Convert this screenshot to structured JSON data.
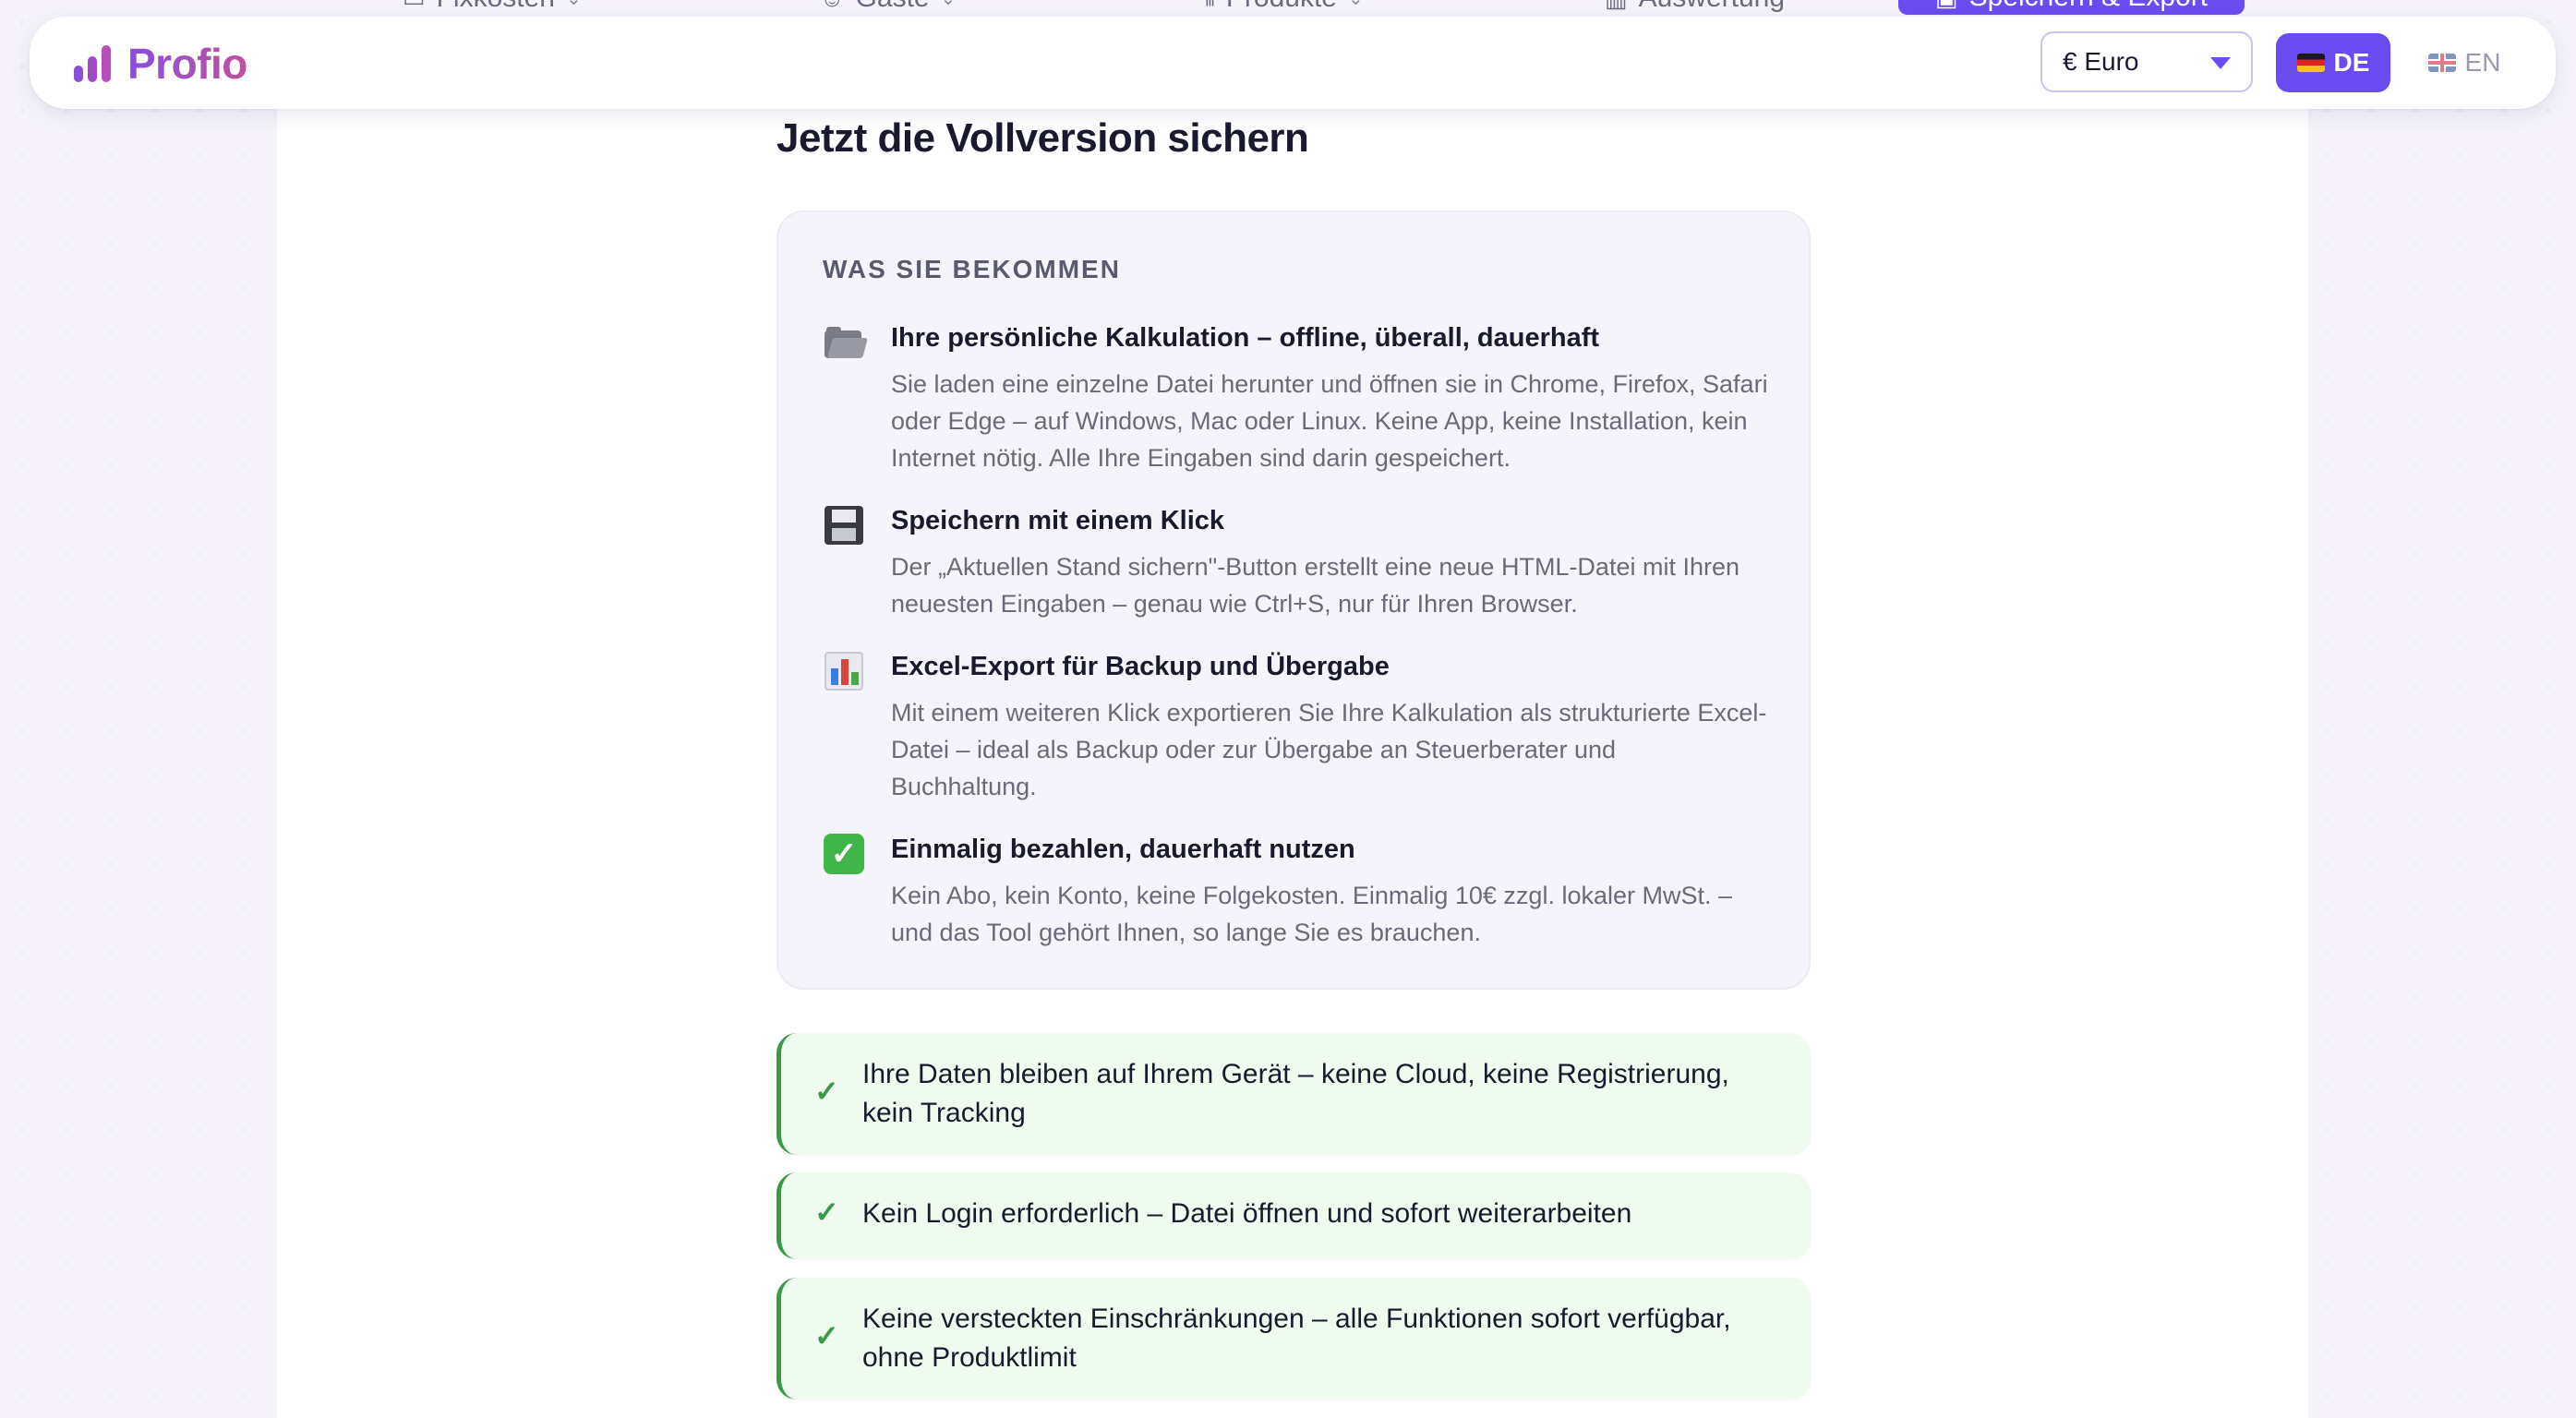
{
  "tabs": [
    {
      "label": "Fixkosten",
      "icon": "file-icon"
    },
    {
      "label": "Gäste",
      "icon": "users-icon"
    },
    {
      "label": "Produkte",
      "icon": "products-icon"
    },
    {
      "label": "Auswertung",
      "icon": "chart-icon"
    },
    {
      "label": "Speichern & Export",
      "icon": "save-icon",
      "active": true
    }
  ],
  "header": {
    "logo_text": "Profio",
    "currency": {
      "value": "€ Euro"
    },
    "lang_de": "DE",
    "lang_en": "EN"
  },
  "main": {
    "title": "Jetzt die Vollversion sichern",
    "card_label": "WAS SIE BEKOMMEN",
    "benefits": [
      {
        "icon": "folder-icon",
        "title": "Ihre persönliche Kalkulation – offline, überall, dauerhaft",
        "body": "Sie laden eine einzelne Datei herunter und öffnen sie in Chrome, Firefox, Safari oder Edge – auf Windows, Mac oder Linux. Keine App, keine Installation, kein Internet nötig. Alle Ihre Eingaben sind darin gespeichert."
      },
      {
        "icon": "floppy-disk-icon",
        "title": "Speichern mit einem Klick",
        "body": "Der „Aktuellen Stand sichern\"-Button erstellt eine neue HTML-Datei mit Ihren neuesten Eingaben – genau wie Ctrl+S, nur für Ihren Browser."
      },
      {
        "icon": "bar-chart-icon",
        "title": "Excel-Export für Backup und Übergabe",
        "body": "Mit einem weiteren Klick exportieren Sie Ihre Kalkulation als strukturierte Excel-Datei – ideal als Backup oder zur Übergabe an Steuerberater und Buchhaltung."
      },
      {
        "icon": "check-box-icon",
        "title": "Einmalig bezahlen, dauerhaft nutzen",
        "body": "Kein Abo, kein Konto, keine Folgekosten. Einmalig 10€ zzgl. lokaler MwSt. – und das Tool gehört Ihnen, so lange Sie es brauchen."
      }
    ],
    "assurances": [
      "Ihre Daten bleiben auf Ihrem Gerät – keine Cloud, keine Registrierung, kein Tracking",
      "Kein Login erforderlich – Datei öffnen und sofort weiterarbeiten",
      "Keine versteckten Einschränkungen – alle Funktionen sofort verfügbar, ohne Produktlimit"
    ]
  },
  "colors": {
    "accent": "#6b4cf0",
    "success": "#3a9a46",
    "success_bg": "#f0fbef"
  }
}
